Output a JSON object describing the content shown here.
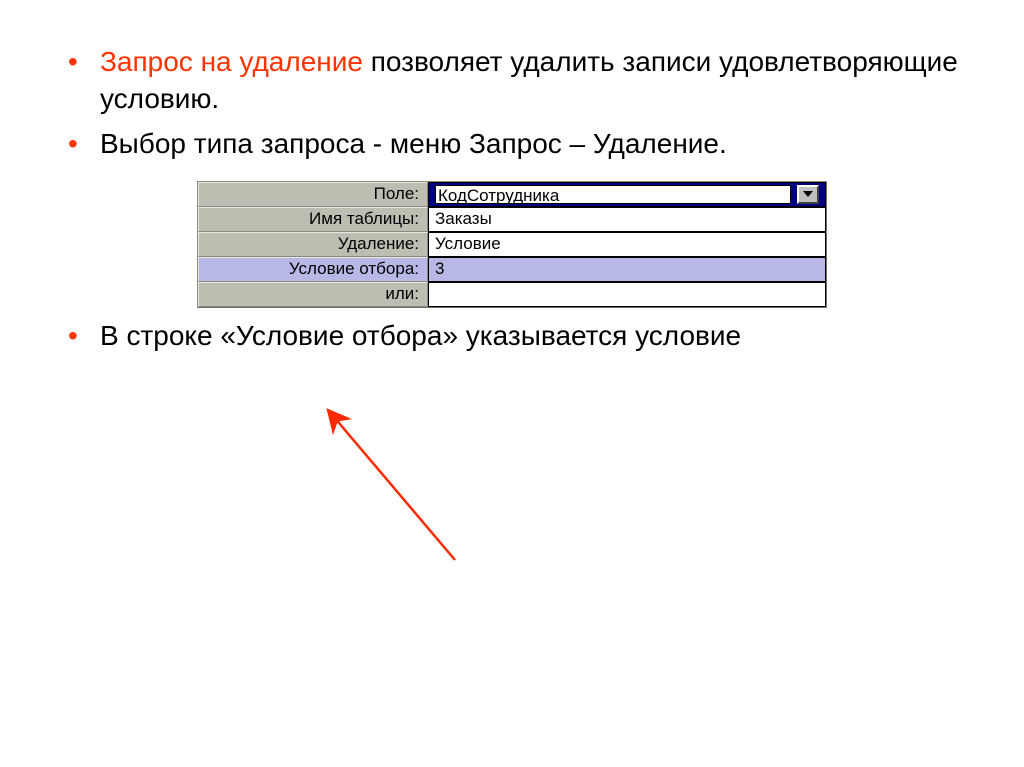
{
  "bullets": {
    "b1_highlight": "Запрос на удаление",
    "b1_rest": " позволяет удалить записи удовлетворяющие условию.",
    "b2": "Выбор типа запроса - меню Запрос – Удаление.",
    "b3": "В строке «Условие отбора» указывается условие"
  },
  "grid": {
    "labels": {
      "field": "Поле:",
      "table": "Имя таблицы:",
      "delete": "Удаление:",
      "criteria": "Условие отбора:",
      "or": "или:"
    },
    "values": {
      "field": "КодСотрудника",
      "table": "Заказы",
      "delete": "Условие",
      "criteria": "3",
      "or": ""
    }
  }
}
